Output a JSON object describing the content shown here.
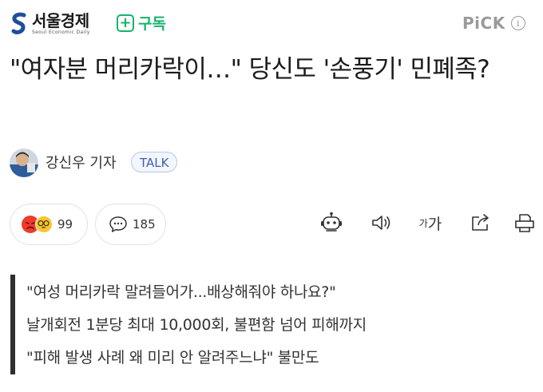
{
  "header": {
    "logo_name": "서울경제",
    "logo_sub": "Seoul Economic Daily",
    "subscribe_label": "구독",
    "pick_label": "PiCK",
    "info_glyph": "i"
  },
  "headline": "\"여자분 머리카락이…\" 당신도 '손풍기' 민폐족?",
  "byline": {
    "reporter": "강신우 기자",
    "talk_label": "TALK"
  },
  "reactions": {
    "emotion_count": "99",
    "comment_count": "185"
  },
  "tools": {
    "font_small": "가",
    "font_large": "가"
  },
  "summary": [
    "\"여성 머리카락 말려들어가...배상해줘야 하나요?\"",
    "날개회전 1분당 최대 10,000회, 불편함 넘어 피해까지",
    "\"피해 발생 사례 왜 미리 안 알려주느냐\" 불만도"
  ],
  "colors": {
    "subscribe_green": "#18b36b",
    "talk_blue": "#3d5fb0",
    "angry_red": "#ee3a2a",
    "emoji_yellow": "#f7c531"
  }
}
